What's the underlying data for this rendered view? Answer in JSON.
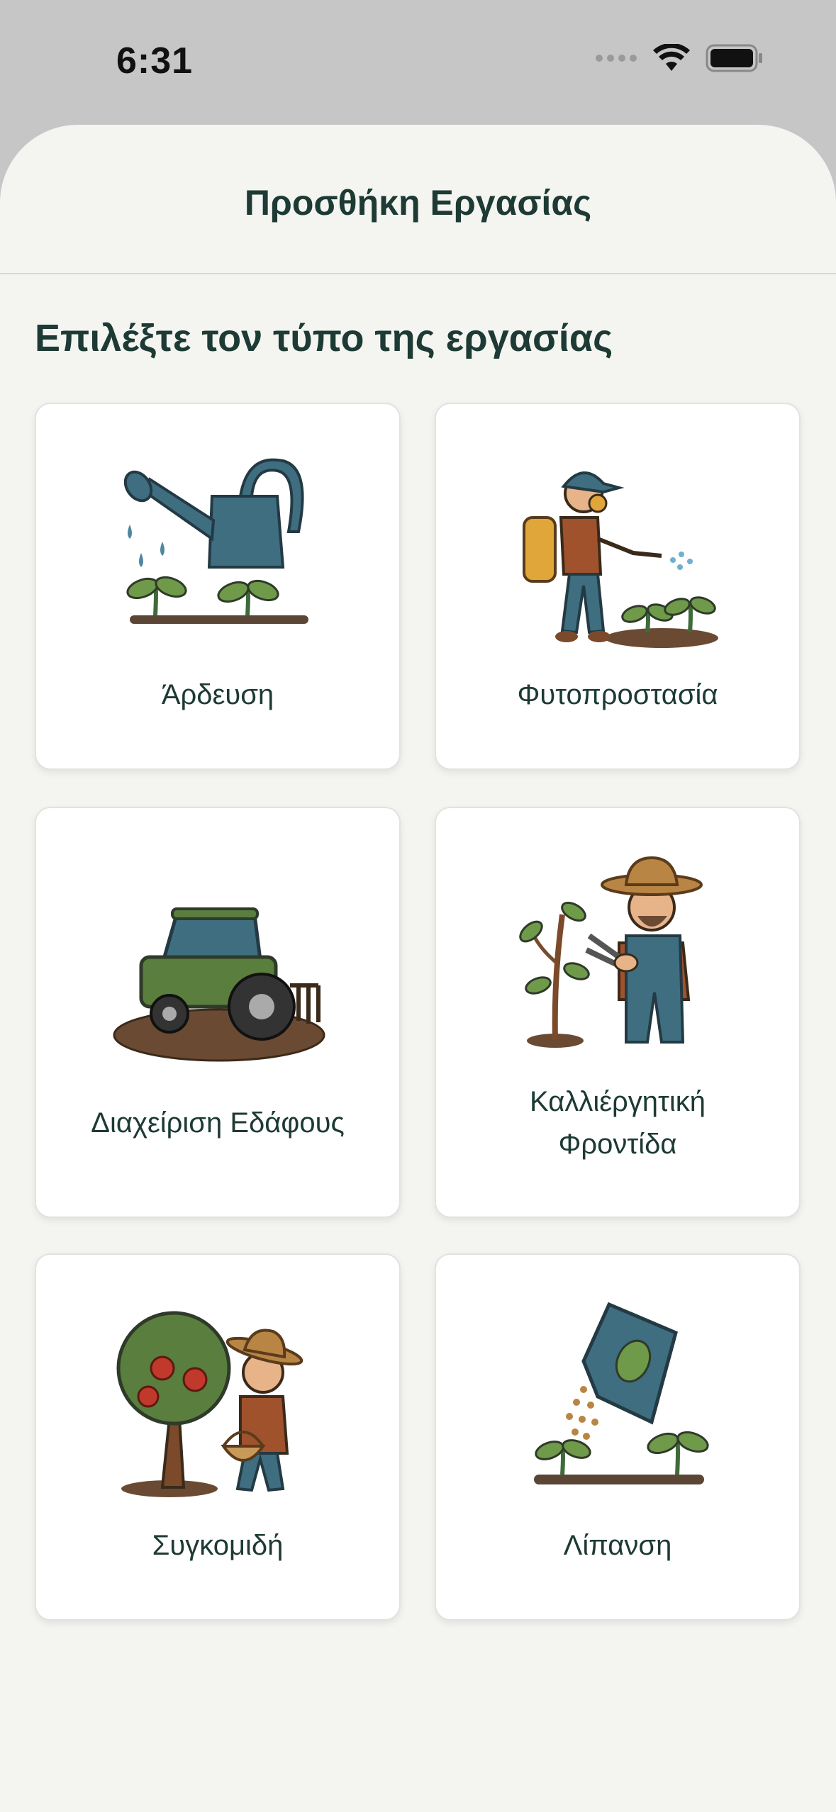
{
  "status_bar": {
    "time": "6:31",
    "icons": [
      "cellular-dots-icon",
      "wifi-icon",
      "battery-icon"
    ]
  },
  "sheet": {
    "title": "Προσθήκη Εργασίας",
    "section_title": "Επιλέξτε τον τύπο της εργασίας"
  },
  "tasks": [
    {
      "label": "Άρδευση",
      "icon": "watering-can-icon"
    },
    {
      "label": "Φυτοπροστασία",
      "icon": "sprayer-worker-icon"
    },
    {
      "label": "Διαχείριση Εδάφους",
      "icon": "tractor-icon"
    },
    {
      "label_line1": "Καλλιέργητική",
      "label_line2": "Φροντίδα",
      "icon": "pruning-farmer-icon"
    },
    {
      "label": "Συγκομιδή",
      "icon": "harvest-apple-tree-icon"
    },
    {
      "label": "Λίπανση",
      "icon": "fertilizer-bag-icon"
    }
  ],
  "colors": {
    "background": "#f4f4f1",
    "text": "#1d3a34",
    "card": "#ffffff",
    "status_bar": "#c6c6c6"
  }
}
